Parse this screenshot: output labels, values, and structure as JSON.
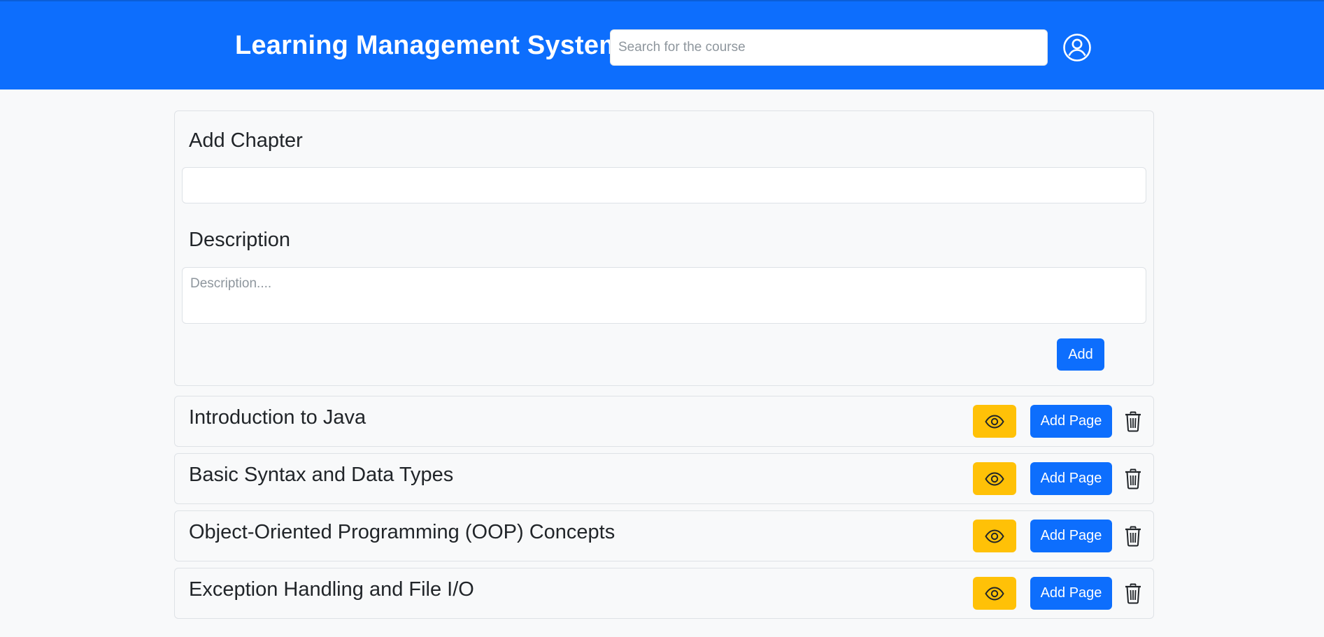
{
  "header": {
    "title": "Learning Management System",
    "search_placeholder": "Search for the course",
    "search_value": "",
    "profile_icon": "person-circle-icon"
  },
  "add_chapter_form": {
    "chapter_label": "Add Chapter",
    "chapter_value": "",
    "description_label": "Description",
    "description_placeholder": "Description....",
    "description_value": "",
    "add_button_label": "Add"
  },
  "chapters": [
    {
      "title": "Introduction to Java",
      "view_icon": "eye-icon",
      "add_page_label": "Add Page",
      "delete_icon": "trash-icon"
    },
    {
      "title": "Basic Syntax and Data Types",
      "view_icon": "eye-icon",
      "add_page_label": "Add Page",
      "delete_icon": "trash-icon"
    },
    {
      "title": "Object-Oriented Programming (OOP) Concepts",
      "view_icon": "eye-icon",
      "add_page_label": "Add Page",
      "delete_icon": "trash-icon"
    },
    {
      "title": "Exception Handling and File I/O",
      "view_icon": "eye-icon",
      "add_page_label": "Add Page",
      "delete_icon": "trash-icon"
    }
  ],
  "colors": {
    "primary": "#0d6efd",
    "warning": "#ffc107",
    "background": "#f8f9fa",
    "border": "#dee2e6",
    "text": "#212529"
  }
}
